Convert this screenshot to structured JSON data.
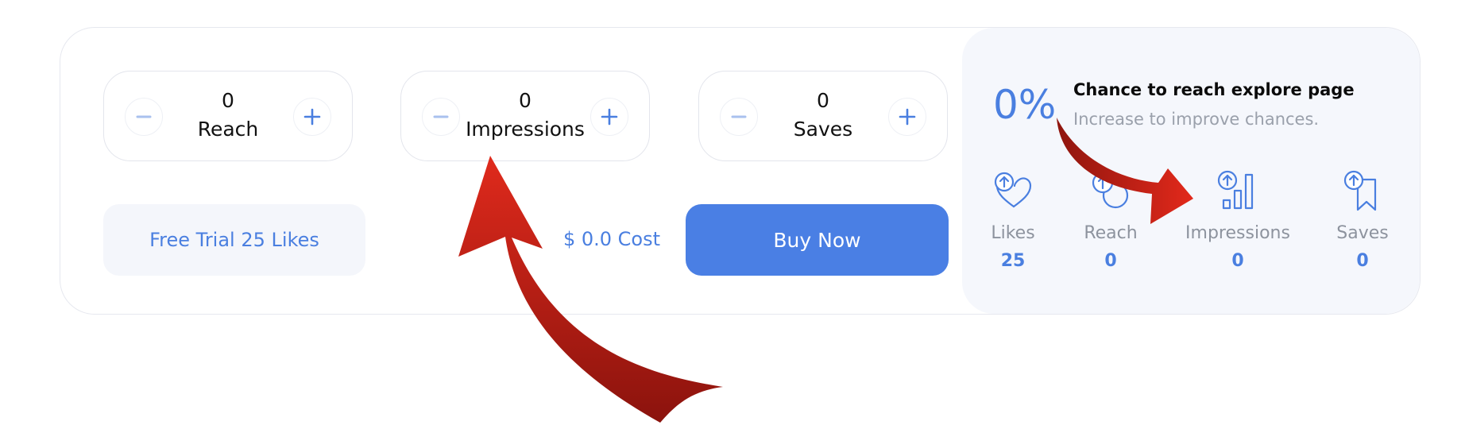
{
  "steppers": [
    {
      "value": "0",
      "label": "Reach"
    },
    {
      "value": "0",
      "label": "Impressions"
    },
    {
      "value": "0",
      "label": "Saves"
    }
  ],
  "actions": {
    "trial_label": "Free Trial 25 Likes",
    "cost_label": "$ 0.0 Cost",
    "buy_label": "Buy Now"
  },
  "explore": {
    "percent": "0%",
    "title": "Chance to reach explore page",
    "subtitle": "Increase to improve chances."
  },
  "stats": [
    {
      "label": "Likes",
      "value": "25",
      "icon": "heart-up-icon"
    },
    {
      "label": "Reach",
      "value": "0",
      "icon": "reach-up-icon"
    },
    {
      "label": "Impressions",
      "value": "0",
      "icon": "bar-chart-up-icon"
    },
    {
      "label": "Saves",
      "value": "0",
      "icon": "bookmark-up-icon"
    }
  ],
  "colors": {
    "accent": "#4a7fe4",
    "panel_bg": "#f5f7fc",
    "annotation_arrow": "#c8231a"
  }
}
